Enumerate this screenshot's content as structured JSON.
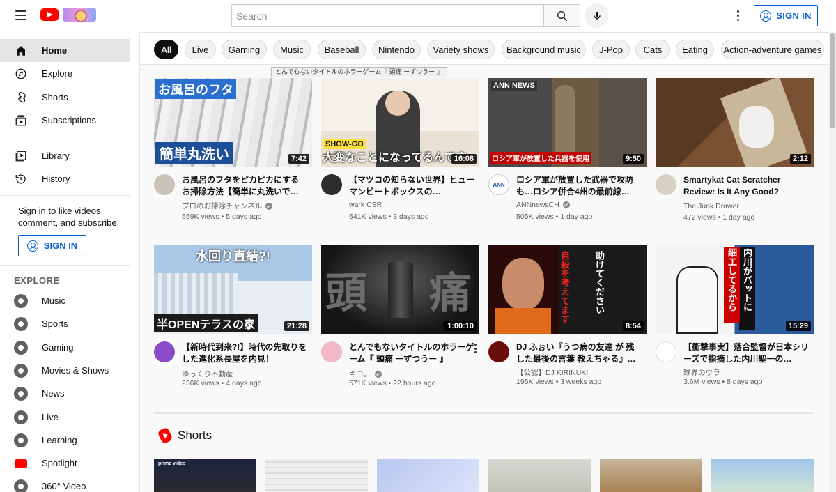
{
  "masthead": {
    "search_placeholder": "Search",
    "signin_label": "SIGN IN"
  },
  "sidebar": {
    "primary": [
      {
        "label": "Home",
        "icon": "home-icon",
        "active": true
      },
      {
        "label": "Explore",
        "icon": "compass-icon"
      },
      {
        "label": "Shorts",
        "icon": "shorts-icon"
      },
      {
        "label": "Subscriptions",
        "icon": "subscriptions-icon"
      }
    ],
    "secondary": [
      {
        "label": "Library",
        "icon": "library-icon"
      },
      {
        "label": "History",
        "icon": "history-icon"
      }
    ],
    "signin_text": "Sign in to like videos, comment, and subscribe.",
    "signin_label": "SIGN IN",
    "explore_header": "EXPLORE",
    "explore": [
      {
        "label": "Music",
        "icon": "music-icon"
      },
      {
        "label": "Sports",
        "icon": "trophy-icon"
      },
      {
        "label": "Gaming",
        "icon": "gaming-icon"
      },
      {
        "label": "Movies & Shows",
        "icon": "film-icon"
      },
      {
        "label": "News",
        "icon": "news-icon"
      },
      {
        "label": "Live",
        "icon": "live-icon"
      },
      {
        "label": "Learning",
        "icon": "bulb-icon"
      },
      {
        "label": "Spotlight",
        "icon": "spotlight-icon"
      },
      {
        "label": "360° Video",
        "icon": "vr-icon"
      }
    ]
  },
  "chips": [
    "All",
    "Live",
    "Gaming",
    "Music",
    "Baseball",
    "Nintendo",
    "Variety shows",
    "Background music",
    "J-Pop",
    "Cats",
    "Eating",
    "Action-adventure games"
  ],
  "tooltip": "とんでもないタイトルのホラーゲーム『 頭痛 ーずつうー 』",
  "videos": [
    {
      "title": "お風呂のフタをピカピカにするお掃除方法【簡単に丸洗いで…",
      "channel": "プロのお掃除チャンネル",
      "verified": true,
      "views": "559K views",
      "age": "5 days ago",
      "duration": "7:42",
      "thumb_caption_top": "お風呂のフタ",
      "thumb_caption_bottom": "簡単丸洗い"
    },
    {
      "title": "【マツコの知らない世界】ヒューマンビートボックスの…",
      "channel": "wark CSR",
      "verified": false,
      "views": "641K views",
      "age": "3 days ago",
      "duration": "16:08",
      "thumb_caption_top": "SHOW-GO",
      "thumb_caption_bottom": "大変なことになってるんです"
    },
    {
      "title": "ロシア軍が放置した武器で攻防も…ロシア併合4州の最前線…",
      "channel": "ANNnewsCH",
      "verified": true,
      "views": "505K views",
      "age": "1 day ago",
      "duration": "9:50",
      "thumb_caption_top": "ANN NEWS",
      "thumb_caption_bottom": "ロシア軍が放置した兵器を使用"
    },
    {
      "title": "Smartykat Cat Scratcher Review: Is It Any Good?",
      "channel": "The Junk Drawer",
      "verified": false,
      "views": "472 views",
      "age": "1 day ago",
      "duration": "2:12",
      "thumb_caption_top": "",
      "thumb_caption_bottom": ""
    },
    {
      "title": "【新時代到来?!】時代の先取りをした進化系長屋を内見！",
      "channel": "ゆっくり不動産",
      "verified": false,
      "views": "236K views",
      "age": "4 days ago",
      "duration": "21:28",
      "thumb_caption_top": "水回り直結?!",
      "thumb_caption_bottom": "半OPENテラスの家"
    },
    {
      "title": "とんでもないタイトルのホラーゲーム『 頭痛 ーずつうー 』",
      "channel": "キヨ。",
      "verified": true,
      "views": "571K views",
      "age": "22 hours ago",
      "duration": "1:00:10",
      "thumb_caption_top": "頭",
      "thumb_caption_bottom": "痛"
    },
    {
      "title": "DJ ふぉい『うつ病の友達 が 残した最後の言葉 教えちゃる』…",
      "channel": "【公認】DJ KIRINUKI",
      "verified": false,
      "views": "195K views",
      "age": "3 weeks ago",
      "duration": "8:54",
      "thumb_caption_top": "助けてください",
      "thumb_caption_bottom": "自殺を考えてます"
    },
    {
      "title": "【衝撃事実】落合監督が日本シリーズで指摘した内川聖一の…",
      "channel": "球界のウラ",
      "verified": false,
      "views": "3.6M views",
      "age": "8 days ago",
      "duration": "15:29",
      "thumb_caption_top": "内川がバットに",
      "thumb_caption_bottom": "細工してるから"
    }
  ],
  "shorts": {
    "title": "Shorts",
    "items": [
      {
        "label": "prime video"
      },
      {
        "label": ""
      },
      {
        "label": ""
      },
      {
        "label": ""
      },
      {
        "label": ""
      },
      {
        "label": ""
      }
    ]
  }
}
